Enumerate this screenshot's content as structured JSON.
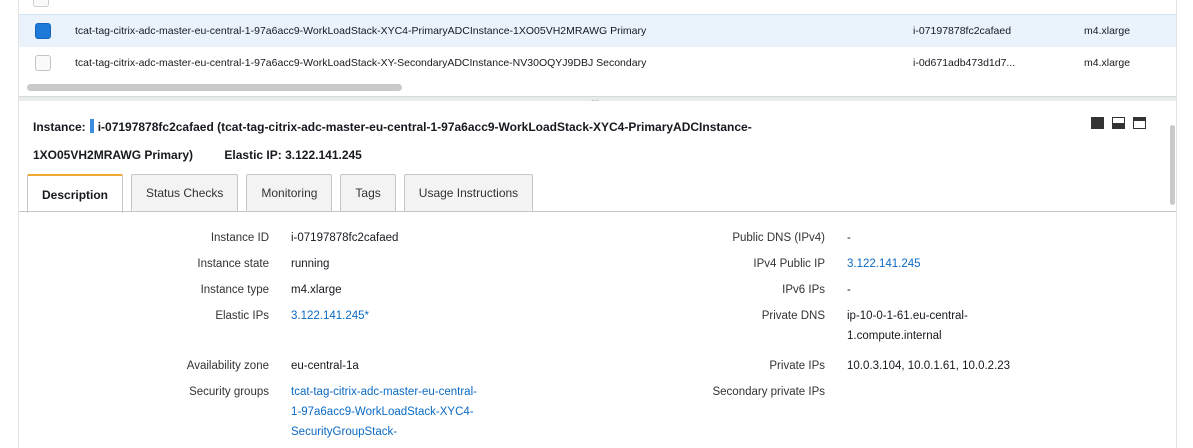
{
  "rows": [
    {
      "name": "tcat-tag-citrix-adc-master-eu-central-1-97a6acc9-WorkLoadStack-XYC4-PrimaryADCInstance-1XO05VH2MRAWG Primary",
      "id": "i-07197878fc2cafaed",
      "type": "m4.xlarge",
      "selected": true
    },
    {
      "name": "tcat-tag-citrix-adc-master-eu-central-1-97a6acc9-WorkLoadStack-XY-SecondaryADCInstance-NV30OQYJ9DBJ Secondary",
      "id": "i-0d671adb473d1d7...",
      "type": "m4.xlarge",
      "selected": false
    }
  ],
  "header": {
    "label": "Instance:",
    "instance_text_1": "i-07197878fc2cafaed (tcat-tag-citrix-adc-master-eu-central-1-97a6acc9-WorkLoadStack-XYC4-PrimaryADCInstance-",
    "instance_text_2": "1XO05VH2MRAWG Primary)",
    "elastic_ip_label": "Elastic IP:",
    "elastic_ip": "3.122.141.245"
  },
  "tabs": [
    "Description",
    "Status Checks",
    "Monitoring",
    "Tags",
    "Usage Instructions"
  ],
  "details": {
    "instance_id_label": "Instance ID",
    "instance_id": "i-07197878fc2cafaed",
    "instance_state_label": "Instance state",
    "instance_state": "running",
    "instance_type_label": "Instance type",
    "instance_type": "m4.xlarge",
    "elastic_ips_label": "Elastic IPs",
    "elastic_ips": "3.122.141.245*",
    "availability_zone_label": "Availability zone",
    "availability_zone": "eu-central-1a",
    "security_groups_label": "Security groups",
    "security_groups_1": "tcat-tag-citrix-adc-master-eu-central-",
    "security_groups_2": "1-97a6acc9-WorkLoadStack-XYC4-",
    "security_groups_3": "SecurityGroupStack-",
    "public_dns_label": "Public DNS (IPv4)",
    "public_dns": "-",
    "ipv4_public_ip_label": "IPv4 Public IP",
    "ipv4_public_ip": "3.122.141.245",
    "ipv6_ips_label": "IPv6 IPs",
    "ipv6_ips": "-",
    "private_dns_label": "Private DNS",
    "private_dns_1": "ip-10-0-1-61.eu-central-",
    "private_dns_2": "1.compute.internal",
    "private_ips_label": "Private IPs",
    "private_ips": "10.0.3.104, 10.0.1.61, 10.0.2.23",
    "secondary_private_ips_label": "Secondary private IPs",
    "secondary_private_ips": ""
  },
  "colors": {
    "accent": "#f0a832",
    "link": "#0b6ac2",
    "selected_row": "#eaf3fb",
    "checkbox": "#1e7ad8"
  },
  "icons": [
    "checkbox-checked-icon",
    "checkbox-unchecked-icon",
    "layout-full-icon",
    "layout-split-icon",
    "layout-top-icon"
  ]
}
